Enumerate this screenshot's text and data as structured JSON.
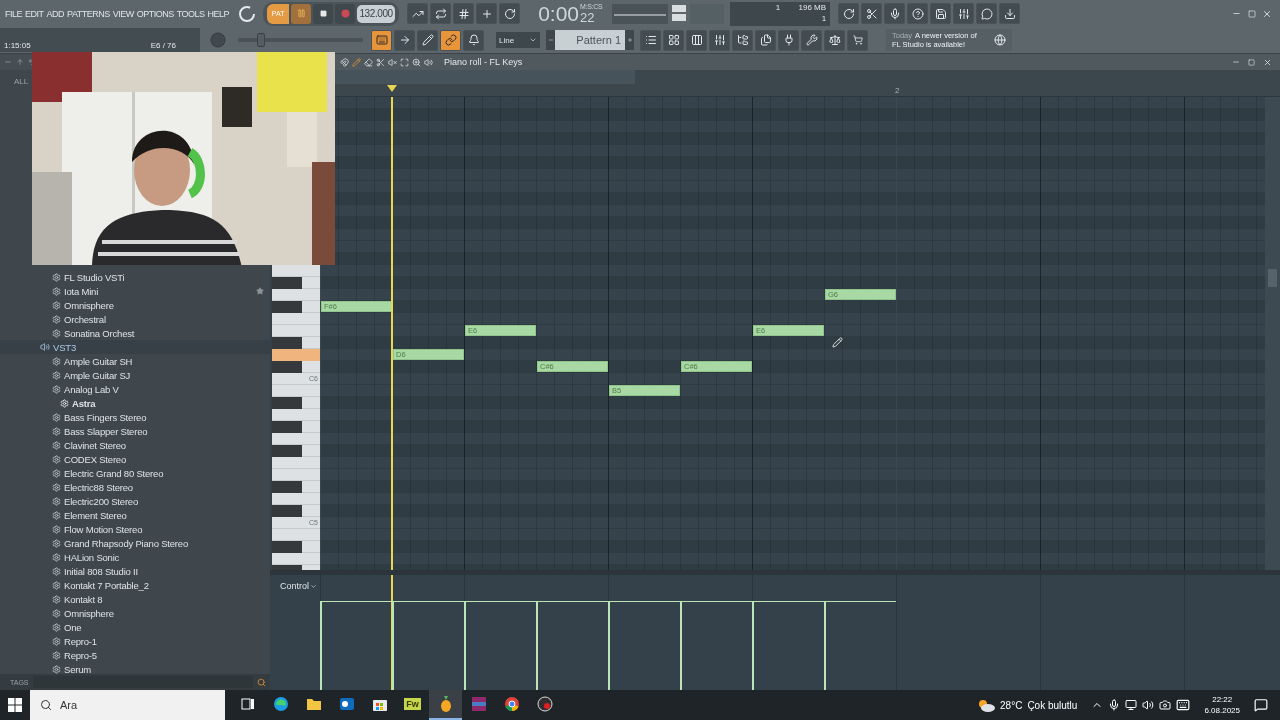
{
  "menu": [
    "FILE",
    "EDIT",
    "ADD",
    "PATTERNS",
    "VIEW",
    "OPTIONS",
    "TOOLS",
    "HELP"
  ],
  "transport": {
    "mode_label": "PAT",
    "pattern_mode": true,
    "playing": true,
    "recording": false,
    "tempo": "132.000"
  },
  "time": {
    "value": "0:00",
    "centis": "22",
    "unit": "M:S:CS"
  },
  "hint": {
    "position": "1:15:05",
    "note": "E6 / 76"
  },
  "cpu": {
    "voices": "1",
    "memory": "196 MB",
    "polyphony": "1"
  },
  "pitch": {
    "level": 0.15
  },
  "tool_buttons": [
    {
      "on": true
    },
    {
      "on": false
    },
    {
      "on": false
    },
    {
      "on": true
    },
    {
      "on": false
    }
  ],
  "snap": "Line",
  "pattern": "Pattern 1",
  "news": {
    "day": "Today",
    "message": "A newer version of FL Studio is available!"
  },
  "browser": {
    "tab": "ALL",
    "tags": "TAGS",
    "items": [
      {
        "label": "FL Studio VSTi",
        "kind": "plugin",
        "starred": false
      },
      {
        "label": "Iota Mini",
        "kind": "plugin",
        "starred": true
      },
      {
        "label": "Omnisphere",
        "kind": "plugin",
        "starred": false
      },
      {
        "label": "Orchestral",
        "kind": "plugin",
        "starred": false
      },
      {
        "label": "Sonatina Orchest",
        "kind": "plugin",
        "starred": false
      },
      {
        "label": "VST3",
        "kind": "folder",
        "starred": false,
        "children": [
          {
            "label": "Ample Guitar SH",
            "kind": "plugin",
            "starred": false
          },
          {
            "label": "Ample Guitar SJ",
            "kind": "plugin",
            "starred": false
          },
          {
            "label": "Analog Lab V",
            "kind": "plugin",
            "starred": false,
            "children": [
              {
                "label": "Astra",
                "kind": "preset",
                "starred": false
              }
            ]
          },
          {
            "label": "Bass Fingers Stereo",
            "kind": "plugin",
            "starred": false
          },
          {
            "label": "Bass Slapper Stereo",
            "kind": "plugin",
            "starred": false
          },
          {
            "label": "Clavinet Stereo",
            "kind": "plugin",
            "starred": false
          },
          {
            "label": "CODEX Stereo",
            "kind": "plugin",
            "starred": false
          },
          {
            "label": "Electric Grand 80 Stereo",
            "kind": "plugin",
            "starred": false
          },
          {
            "label": "Electric88 Stereo",
            "kind": "plugin",
            "starred": false
          },
          {
            "label": "Electric200 Stereo",
            "kind": "plugin",
            "starred": false
          },
          {
            "label": "Element Stereo",
            "kind": "plugin",
            "starred": false
          },
          {
            "label": "Flow Motion Stereo",
            "kind": "plugin",
            "starred": false
          },
          {
            "label": "Grand Rhapsody Piano Stereo",
            "kind": "plugin",
            "starred": false
          },
          {
            "label": "HALion Sonic",
            "kind": "plugin",
            "starred": false
          },
          {
            "label": "Initial 808 Studio II",
            "kind": "plugin",
            "starred": false
          },
          {
            "label": "Kontakt 7 Portable_2",
            "kind": "plugin",
            "starred": false
          },
          {
            "label": "Kontakt 8",
            "kind": "plugin",
            "starred": false
          },
          {
            "label": "Omnisphere",
            "kind": "plugin",
            "starred": false
          },
          {
            "label": "One",
            "kind": "plugin",
            "starred": false
          },
          {
            "label": "Repro-1",
            "kind": "plugin",
            "starred": false
          },
          {
            "label": "Repro-5",
            "kind": "plugin",
            "starred": false
          },
          {
            "label": "Serum",
            "kind": "plugin",
            "starred": false
          }
        ]
      }
    ]
  },
  "piano_roll": {
    "title": "Piano roll - FL Keys",
    "bar_label": "2",
    "lane": "Control",
    "key_pressed": true,
    "key_labels": [
      "C6",
      "C5"
    ],
    "notes": [
      {
        "label": "F#6",
        "level": 0.77
      },
      {
        "label": "D6",
        "level": 0.77
      },
      {
        "label": "E6",
        "level": 0.77
      },
      {
        "label": "C#6",
        "level": 0.77
      },
      {
        "label": "B5",
        "level": 0.77
      },
      {
        "label": "C#6",
        "level": 0.77
      },
      {
        "label": "E6",
        "level": 0.77
      },
      {
        "label": "G6",
        "level": 0.77
      }
    ]
  },
  "taskbar": {
    "search": "Ara",
    "temperature": "28°C",
    "weather": "Çok bulutlu",
    "time": "22:22",
    "date": "6.08.2025",
    "apps": [
      {
        "kind": "task-view",
        "active": false
      },
      {
        "kind": "edge",
        "active": false
      },
      {
        "kind": "explorer",
        "active": false
      },
      {
        "kind": "mail",
        "active": false
      },
      {
        "kind": "store",
        "active": false
      },
      {
        "kind": "fireworks",
        "label": "Fw",
        "active": false
      },
      {
        "kind": "fl-studio",
        "active": true
      },
      {
        "kind": "archive",
        "active": false
      },
      {
        "kind": "chrome",
        "active": false
      },
      {
        "kind": "recorder",
        "active": false
      }
    ]
  }
}
